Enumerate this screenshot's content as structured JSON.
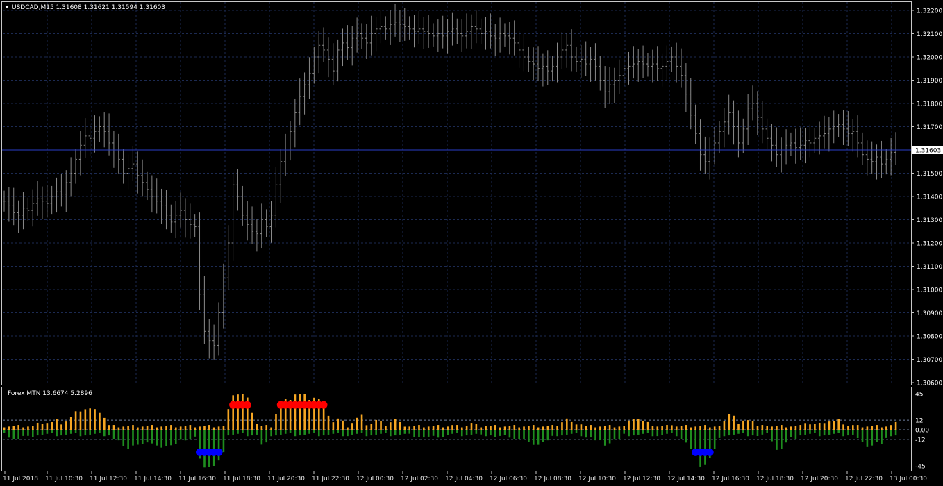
{
  "main": {
    "header_text": "USDCAD,M15  1.31608 1.31621 1.31594 1.31603",
    "current_price_label": "1.31603",
    "price_ticks": [
      "1.32200",
      "1.32100",
      "1.32000",
      "1.31900",
      "1.31800",
      "1.31700",
      "1.31500",
      "1.31400",
      "1.31300",
      "1.31200",
      "1.31100",
      "1.31000",
      "1.30900",
      "1.30800",
      "1.30700",
      "1.30600"
    ]
  },
  "indicator": {
    "header_text": "Forex MTN  13.6674 5.2896",
    "level_labels": [
      "45",
      "12",
      "0.00",
      "-12",
      "-45"
    ]
  },
  "time_axis": {
    "labels": [
      "11 Jul 2018",
      "11 Jul 10:30",
      "11 Jul 12:30",
      "11 Jul 14:30",
      "11 Jul 16:30",
      "11 Jul 18:30",
      "11 Jul 20:30",
      "11 Jul 22:30",
      "12 Jul 00:30",
      "12 Jul 02:30",
      "12 Jul 04:30",
      "12 Jul 06:30",
      "12 Jul 08:30",
      "12 Jul 10:30",
      "12 Jul 12:30",
      "12 Jul 14:30",
      "12 Jul 16:30",
      "12 Jul 18:30",
      "12 Jul 20:30",
      "12 Jul 22:30",
      "13 Jul 00:30"
    ]
  },
  "colors": {
    "background": "#000000",
    "grid": "#1c2a52",
    "frame": "#c8c8c8",
    "candles": "#8a8a8a",
    "current_price_line": "#2a3ec8",
    "hist_up": "#f5a623",
    "hist_down": "#1e8c1e",
    "signal_sell": "#ff0000",
    "signal_buy": "#0000ff"
  },
  "chart_data": {
    "type": "candlestick",
    "symbol": "USDCAD",
    "timeframe": "M15",
    "ylim": [
      1.306,
      1.3225
    ],
    "current_price": 1.31603,
    "closes": [
      1.3138,
      1.3136,
      1.3133,
      1.3132,
      1.3135,
      1.3134,
      1.3137,
      1.3139,
      1.3138,
      1.3137,
      1.314,
      1.3142,
      1.3141,
      1.3146,
      1.315,
      1.3156,
      1.3162,
      1.3166,
      1.3165,
      1.3168,
      1.317,
      1.3168,
      1.3163,
      1.316,
      1.3156,
      1.315,
      1.3152,
      1.3154,
      1.3149,
      1.3146,
      1.3143,
      1.314,
      1.3138,
      1.3136,
      1.3132,
      1.3129,
      1.3132,
      1.3134,
      1.313,
      1.3128,
      1.3127,
      1.3098,
      1.3082,
      1.3078,
      1.3076,
      1.309,
      1.3105,
      1.312,
      1.3145,
      1.314,
      1.3132,
      1.3128,
      1.3125,
      1.3124,
      1.313,
      1.3127,
      1.3132,
      1.3145,
      1.3155,
      1.316,
      1.3168,
      1.3176,
      1.3183,
      1.3188,
      1.3193,
      1.32,
      1.3205,
      1.3203,
      1.3199,
      1.3194,
      1.3203,
      1.3206,
      1.3204,
      1.3208,
      1.321,
      1.3208,
      1.3206,
      1.321,
      1.3212,
      1.3213,
      1.3212,
      1.3214,
      1.3215,
      1.3214,
      1.3213,
      1.3212,
      1.3211,
      1.3212,
      1.3211,
      1.321,
      1.3209,
      1.321,
      1.3209,
      1.3211,
      1.3212,
      1.321,
      1.3209,
      1.3211,
      1.3213,
      1.3212,
      1.321,
      1.3211,
      1.3209,
      1.3208,
      1.321,
      1.3209,
      1.3208,
      1.3206,
      1.3203,
      1.32,
      1.3198,
      1.3197,
      1.3195,
      1.3196,
      1.3194,
      1.3196,
      1.32,
      1.3203,
      1.3205,
      1.32,
      1.3198,
      1.3199,
      1.3197,
      1.3199,
      1.3196,
      1.319,
      1.3185,
      1.3188,
      1.319,
      1.3192,
      1.3195,
      1.3196,
      1.3197,
      1.3198,
      1.3197,
      1.3196,
      1.3197,
      1.3195,
      1.3196,
      1.3198,
      1.32,
      1.3196,
      1.3192,
      1.3184,
      1.3175,
      1.3167,
      1.3158,
      1.3155,
      1.316,
      1.3163,
      1.3168,
      1.3172,
      1.3176,
      1.317,
      1.3163,
      1.3169,
      1.3178,
      1.318,
      1.3174,
      1.3169,
      1.3165,
      1.3162,
      1.3158,
      1.316,
      1.3162,
      1.3163,
      1.3161,
      1.3162,
      1.3164,
      1.3163,
      1.3165,
      1.3166,
      1.3167,
      1.3169,
      1.317,
      1.3171,
      1.3169,
      1.3167,
      1.3168,
      1.3163,
      1.3158,
      1.3156,
      1.3155,
      1.3157,
      1.3154,
      1.3156,
      1.3159,
      1.316
    ],
    "indicator": {
      "name": "Forex MTN",
      "values": [
        13.6674,
        5.2896
      ],
      "levels": [
        45,
        12,
        0,
        -12,
        -45
      ]
    }
  }
}
